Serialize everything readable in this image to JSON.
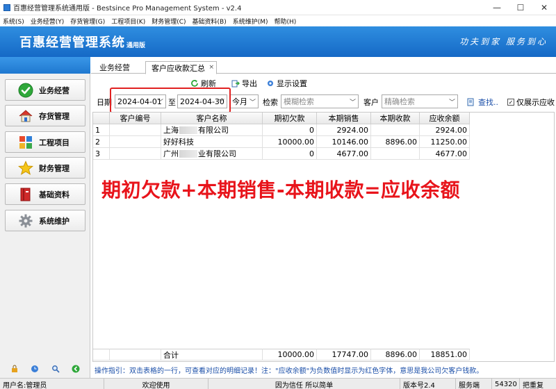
{
  "window": {
    "title": "百惠经营管理系统通用版 - Bestsince Pro Management System - v2.4",
    "min_glyph": "—",
    "max_glyph": "☐",
    "close_glyph": "✕"
  },
  "menu": [
    "系统(S)",
    "业务经营(Y)",
    "存货管理(G)",
    "工程项目(K)",
    "财务管理(C)",
    "基础资料(B)",
    "系统维护(M)",
    "帮助(H)"
  ],
  "banner": {
    "brand": "百惠经营管理系统",
    "brand_sub": "通用版",
    "slogan": "功夫到家  服务到心",
    "bg_color": "#1a70cc"
  },
  "sidebar": {
    "items": [
      {
        "label": "业务经营",
        "icon": "check-circle-icon"
      },
      {
        "label": "存货管理",
        "icon": "house-icon"
      },
      {
        "label": "工程项目",
        "icon": "puzzle-icon"
      },
      {
        "label": "财务管理",
        "icon": "star-icon"
      },
      {
        "label": "基础资料",
        "icon": "book-icon"
      },
      {
        "label": "系统维护",
        "icon": "gear-icon"
      }
    ]
  },
  "tabs": [
    {
      "label": "业务经营"
    },
    {
      "label": "客户应收款汇总",
      "close": "×"
    }
  ],
  "toolbar": {
    "refresh": "刷新",
    "export": "导出",
    "display_settings": "显示设置"
  },
  "filter": {
    "date_label": "日期",
    "date_from": "2024-04-01",
    "to_label": "至",
    "date_to": "2024-04-30",
    "period": "今月",
    "search_label": "检索",
    "search_placeholder": "模糊检索",
    "customer_label": "客户",
    "customer_placeholder": "精确检索",
    "find_link": "查找..",
    "only_show_label": "仅展示应收",
    "only_show_checked": true,
    "highlight_color": "#e02020"
  },
  "grid": {
    "columns": [
      "客户编号",
      "客户名称",
      "期初欠款",
      "本期销售",
      "本期收款",
      "应收余额"
    ],
    "rows": [
      {
        "no": "1",
        "code": "",
        "name_pre": "上海",
        "name_post": "有限公司",
        "opening": "0",
        "sales": "2924.00",
        "received": "",
        "balance": "2924.00"
      },
      {
        "no": "2",
        "code": "",
        "name_pre": "好好科技",
        "name_post": "",
        "opening": "10000.00",
        "sales": "10146.00",
        "received": "8896.00",
        "balance": "11250.00"
      },
      {
        "no": "3",
        "code": "",
        "name_pre": "广州",
        "name_post": "业有限公司",
        "opening": "0",
        "sales": "4677.00",
        "received": "",
        "balance": "4677.00"
      }
    ],
    "footer": {
      "label": "合计",
      "opening": "10000.00",
      "sales": "17747.00",
      "received": "8896.00",
      "balance": "18851.00"
    }
  },
  "overlay_text": "期初欠款+本期销售-本期收款=应收余额",
  "overlay_color": "#e8141b",
  "hint": "操作指引：双击表格的一行，可查看对应的明细记录！注：\"应收余额\"为负数值时显示为红色字体，意思是我公司欠客户钱款。",
  "status": {
    "user": "用户名:管理员",
    "welcome": "欢迎使用",
    "motto": "因为信任 所以简单",
    "version": "版本号2.4",
    "server": "服务端",
    "port": "54320",
    "reset": "把重复"
  }
}
